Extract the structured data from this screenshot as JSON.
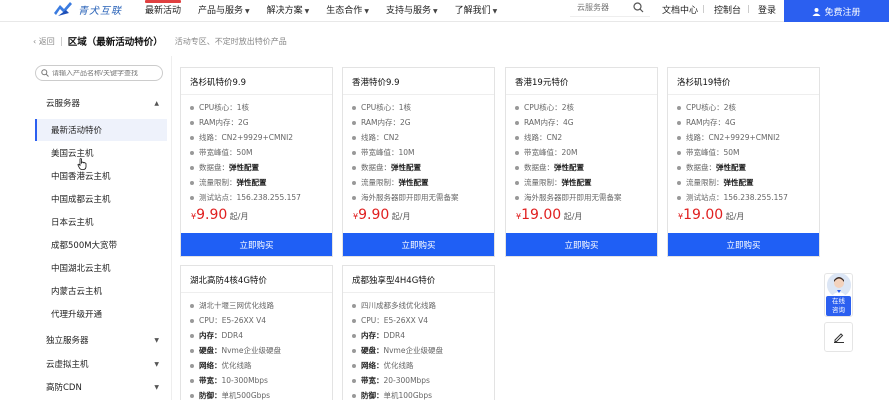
{
  "header": {
    "logo_text": "青犬互联",
    "nav": [
      {
        "label": "最新活动",
        "caret": false
      },
      {
        "label": "产品与服务",
        "caret": true
      },
      {
        "label": "解决方案",
        "caret": true
      },
      {
        "label": "生态合作",
        "caret": true
      },
      {
        "label": "支持与服务",
        "caret": true
      },
      {
        "label": "了解我们",
        "caret": true
      }
    ],
    "search_placeholder": "云服务器",
    "doc_center": "文档中心",
    "console": "控制台",
    "login": "登录",
    "register": "免费注册"
  },
  "breadcrumb": {
    "back": "返回",
    "title": "区域（最新活动特价）",
    "desc": "活动专区、不定时放出特价产品"
  },
  "sidebar": {
    "search_placeholder": "请输入产品名称/关键字查找",
    "groups": [
      {
        "label": "云服务器",
        "expanded": true
      },
      {
        "label": "独立服务器",
        "expanded": false
      },
      {
        "label": "云虚拟主机",
        "expanded": false
      },
      {
        "label": "高防CDN",
        "expanded": false
      }
    ],
    "items": [
      "最新活动特价",
      "美国云主机",
      "中国香港云主机",
      "中国成都云主机",
      "日本云主机",
      "成都500M大宽带",
      "中国湖北云主机",
      "内蒙古云主机",
      "代理升级开通"
    ]
  },
  "cards": [
    {
      "title": "洛杉矶特价9.9",
      "specs": [
        {
          "k": "CPU核心：",
          "v": "1核",
          "bold": false
        },
        {
          "k": "RAM内存：",
          "v": "2G",
          "bold": false
        },
        {
          "k": "线路：",
          "v": "CN2+9929+CMNI2",
          "bold": false
        },
        {
          "k": "带宽峰值：",
          "v": "50M",
          "bold": false
        },
        {
          "k": "数据盘：",
          "v": "弹性配置",
          "bold": true
        },
        {
          "k": "流量限制：",
          "v": "弹性配置",
          "bold": true
        },
        {
          "k": "测试站点：",
          "v": "156.238.255.157",
          "bold": false
        }
      ],
      "price_currency": "¥",
      "price": "9.90",
      "unit": " 起/月",
      "buy": "立即购买"
    },
    {
      "title": "香港特价9.9",
      "specs": [
        {
          "k": "CPU核心：",
          "v": "1核",
          "bold": false
        },
        {
          "k": "RAM内存：",
          "v": "2G",
          "bold": false
        },
        {
          "k": "线路：",
          "v": "CN2",
          "bold": false
        },
        {
          "k": "带宽峰值：",
          "v": "10M",
          "bold": false
        },
        {
          "k": "数据盘：",
          "v": "弹性配置",
          "bold": true
        },
        {
          "k": "流量限制：",
          "v": "弹性配置",
          "bold": true
        },
        {
          "k": "海外服务器即开即用无需备案",
          "v": "",
          "bold": false
        }
      ],
      "price_currency": "¥",
      "price": "9.90",
      "unit": " 起/月",
      "buy": "立即购买"
    },
    {
      "title": "香港19元特价",
      "specs": [
        {
          "k": "CPU核心：",
          "v": "2核",
          "bold": false
        },
        {
          "k": "RAM内存：",
          "v": "4G",
          "bold": false
        },
        {
          "k": "线路：",
          "v": "CN2",
          "bold": false
        },
        {
          "k": "带宽峰值：",
          "v": "20M",
          "bold": false
        },
        {
          "k": "数据盘：",
          "v": "弹性配置",
          "bold": true
        },
        {
          "k": "流量限制：",
          "v": "弹性配置",
          "bold": true
        },
        {
          "k": "海外服务器即开即用无需备案",
          "v": "",
          "bold": false
        }
      ],
      "price_currency": "¥",
      "price": "19.00",
      "unit": " 起/月",
      "buy": "立即购买"
    },
    {
      "title": "洛杉矶19特价",
      "specs": [
        {
          "k": "CPU核心：",
          "v": "2核",
          "bold": false
        },
        {
          "k": "RAM内存：",
          "v": "4G",
          "bold": false
        },
        {
          "k": "线路：",
          "v": "CN2+9929+CMNI2",
          "bold": false
        },
        {
          "k": "带宽峰值：",
          "v": "50M",
          "bold": false
        },
        {
          "k": "数据盘：",
          "v": "弹性配置",
          "bold": true
        },
        {
          "k": "流量限制：",
          "v": "弹性配置",
          "bold": true
        },
        {
          "k": "测试站点：",
          "v": "156.238.255.157",
          "bold": false
        }
      ],
      "price_currency": "¥",
      "price": "19.00",
      "unit": " 起/月",
      "buy": "立即购买"
    },
    {
      "title": "湖北高防4核4G特价",
      "specs": [
        {
          "k": "湖北十堰三网优化线路",
          "v": "",
          "bold": false
        },
        {
          "k": "CPU：",
          "v": "E5-26XX V4",
          "bold": false
        },
        {
          "k": "内存：",
          "v": "DDR4",
          "bold": false,
          "kbold": true
        },
        {
          "k": "硬盘：",
          "v": "Nvme企业级硬盘",
          "bold": false,
          "kbold": true
        },
        {
          "k": "网络：",
          "v": "优化线路",
          "bold": false,
          "kbold": true
        },
        {
          "k": "带宽：",
          "v": "10-300Mbps",
          "bold": false,
          "kbold": true
        },
        {
          "k": "防御：",
          "v": "单机500Gbps",
          "bold": false,
          "kbold": true
        }
      ]
    },
    {
      "title": "成都独享型4H4G特价",
      "specs": [
        {
          "k": "四川成都多线优化线路",
          "v": "",
          "bold": false
        },
        {
          "k": "CPU：",
          "v": "E5-26XX V4",
          "bold": false
        },
        {
          "k": "内存：",
          "v": "DDR4",
          "bold": false,
          "kbold": true
        },
        {
          "k": "硬盘：",
          "v": "Nvme企业级硬盘",
          "bold": false,
          "kbold": true
        },
        {
          "k": "网络：",
          "v": "优化线路",
          "bold": false,
          "kbold": true
        },
        {
          "k": "带宽：",
          "v": "20-300Mbps",
          "bold": false,
          "kbold": true
        },
        {
          "k": "防御：",
          "v": "单机100Gbps",
          "bold": false,
          "kbold": true
        }
      ]
    }
  ],
  "service": {
    "label_line1": "在线",
    "label_line2": "咨询"
  },
  "colors": {
    "brand": "#2b5ff0",
    "buy_button": "#1f5ff5",
    "price": "#e02020"
  }
}
